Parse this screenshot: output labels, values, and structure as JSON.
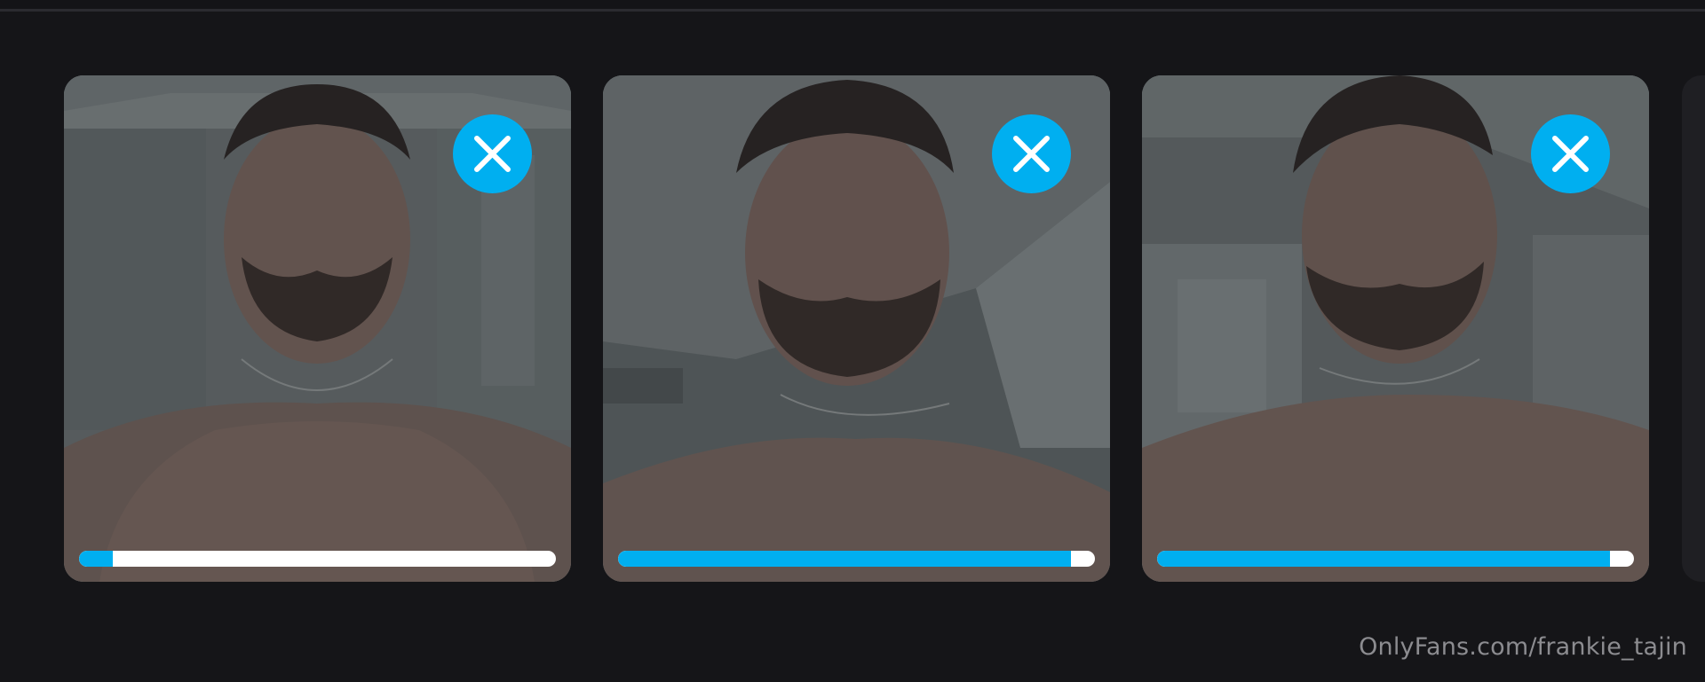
{
  "theme": {
    "accent": "#00aff0",
    "background": "#151518",
    "progress_track": "#ffffff"
  },
  "uploads": [
    {
      "photo_description_icon": "photo-thumbnail",
      "remove_icon": "close-icon",
      "upload_progress": 0.07
    },
    {
      "photo_description_icon": "photo-thumbnail",
      "remove_icon": "close-icon",
      "upload_progress": 0.95
    },
    {
      "photo_description_icon": "photo-thumbnail",
      "remove_icon": "close-icon",
      "upload_progress": 0.95
    }
  ],
  "watermark": {
    "text": "OnlyFans.com/frankie_tajin"
  }
}
